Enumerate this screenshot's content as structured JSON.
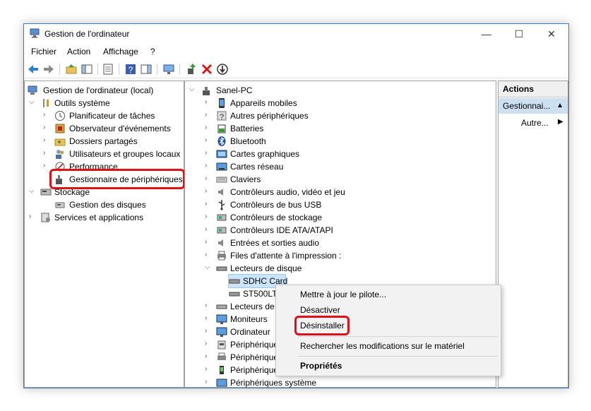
{
  "window": {
    "title": "Gestion de l'ordinateur",
    "controls": {
      "minimize": "—",
      "maximize": "☐",
      "close": "✕"
    }
  },
  "menubar": {
    "items": [
      "Fichier",
      "Action",
      "Affichage",
      "?"
    ]
  },
  "left_tree": {
    "root": "Gestion de l'ordinateur (local)",
    "items": [
      {
        "label": "Outils système",
        "icon": "tools-icon"
      },
      {
        "label": "Planificateur de tâches",
        "icon": "clock-icon"
      },
      {
        "label": "Observateur d'événements",
        "icon": "event-viewer-icon"
      },
      {
        "label": "Dossiers partagés",
        "icon": "shared-folder-icon"
      },
      {
        "label": "Utilisateurs et groupes locaux",
        "icon": "users-icon"
      },
      {
        "label": "Performance",
        "icon": "performance-icon"
      },
      {
        "label": "Gestionnaire de périphériques",
        "icon": "device-manager-icon"
      },
      {
        "label": "Stockage",
        "icon": "storage-icon"
      },
      {
        "label": "Gestion des disques",
        "icon": "disk-icon"
      },
      {
        "label": "Services et applications",
        "icon": "services-icon"
      }
    ]
  },
  "device_tree": {
    "root": "Sanel-PC",
    "categories": [
      "Appareils mobiles",
      "Autres périphériques",
      "Batteries",
      "Bluetooth",
      "Cartes graphiques",
      "Cartes réseau",
      "Claviers",
      "Contrôleurs audio, vidéo et jeu",
      "Contrôleurs de bus USB",
      "Contrôleurs de stockage",
      "Contrôleurs IDE ATA/ATAPI",
      "Entrées et sorties audio",
      "Files d'attente à l'impression :",
      "Lecteurs de disque",
      "SDHC Card",
      "ST500LT0",
      "Lecteurs de l",
      "Moniteurs",
      "Ordinateur",
      "Périphériques",
      "Périphériques",
      "Périphériques",
      "Périphériques système"
    ]
  },
  "actions_pane": {
    "header": "Actions",
    "selected": "Gestionnai...",
    "more": "Autre..."
  },
  "context_menu": {
    "items": [
      "Mettre à jour le pilote...",
      "Désactiver",
      "Désinstaller",
      "Rechercher les modifications sur le matériel",
      "Propriétés"
    ]
  },
  "colors": {
    "highlight": "#e0101a",
    "selection": "#cde0f1",
    "accent": "#1979ca"
  }
}
